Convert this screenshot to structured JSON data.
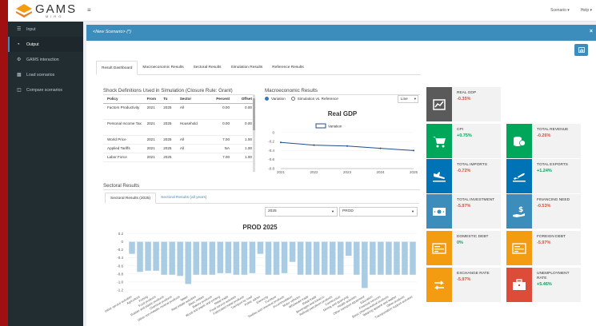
{
  "app": {
    "logo_text": "GAMS",
    "logo_sub": "MIRO"
  },
  "sidebar": {
    "items": [
      {
        "label": "Input",
        "icon": "list-icon"
      },
      {
        "label": "Output",
        "icon": "pie-chart-icon"
      },
      {
        "label": "GAMS interaction",
        "icon": "gear-icon"
      },
      {
        "label": "Load scenarios",
        "icon": "database-icon"
      },
      {
        "label": "Compare scenarios",
        "icon": "columns-icon"
      }
    ]
  },
  "topbar": {
    "scenario_menu": "Scenario ▾",
    "help_menu": "Help ▾"
  },
  "panel": {
    "title": "<New Scenario> (*)",
    "close": "×"
  },
  "tabs": [
    "Result Dashboard",
    "Macroeconomic Results",
    "Sectoral Results",
    "Simulation Results",
    "Reference Results"
  ],
  "shock": {
    "title": "Shock Definitions Used in Simulation (Closure Rule: Grant)",
    "columns": [
      "Policy",
      "From",
      "To",
      "Sector",
      "Percent",
      "Offset"
    ],
    "rows": [
      [
        "Factors Productivity",
        "2021",
        "2025",
        "All",
        "0.00",
        "0.00"
      ],
      [
        "Personal Income Tax",
        "2021",
        "2025",
        "Household",
        "0.00",
        "0.00"
      ],
      [
        "World Price",
        "2021",
        "2025",
        "All",
        "7.00",
        "1.00"
      ],
      [
        "Applied Tariffs",
        "2021",
        "2025",
        "All",
        "NA",
        "1.00"
      ],
      [
        "Labor Force",
        "2021",
        "2025",
        "",
        "7.00",
        "1.00"
      ]
    ]
  },
  "macro": {
    "title": "Macroeconomic Results",
    "radio_variation": "Variation",
    "radio_sim_ref": "Simulation vs. Reference",
    "chart_type_select": "Line"
  },
  "sectoral": {
    "title": "Sectoral Results",
    "tabs": [
      "Sectoral Results (2025)",
      "Sectoral Results (all years)"
    ],
    "year_select": "2025",
    "var_select": "PROD"
  },
  "cards": [
    {
      "label": "REAL GDP",
      "value": "-0.35%",
      "sign": "neg",
      "color": "#5a5a5a",
      "icon": "line-chart-icon"
    },
    {
      "label": "CPI",
      "value": "+0.75%",
      "sign": "pos",
      "color": "#00a65a",
      "icon": "shopping-cart-icon"
    },
    {
      "label": "TOTAL REVENUE",
      "value": "-0.26%",
      "sign": "neg",
      "color": "#00a65a",
      "icon": "coins-icon"
    },
    {
      "label": "TOTAL IMPORTS",
      "value": "-0.72%",
      "sign": "neg",
      "color": "#0073b7",
      "icon": "plane-landing-icon"
    },
    {
      "label": "TOTAL EXPORTS",
      "value": "+1.24%",
      "sign": "pos",
      "color": "#0073b7",
      "icon": "plane-departure-icon"
    },
    {
      "label": "TOTAL INVESTMENT",
      "value": "-5.97%",
      "sign": "neg",
      "color": "#3c8dbc",
      "icon": "money-bill-icon"
    },
    {
      "label": "FINANCING NEED",
      "value": "-0.53%",
      "sign": "neg",
      "color": "#3c8dbc",
      "icon": "hand-dollar-icon"
    },
    {
      "label": "DOMESTIC DEBT",
      "value": "0%",
      "sign": "pos",
      "color": "#f39c12",
      "icon": "receipt-icon"
    },
    {
      "label": "FOREIGN DEBT",
      "value": "-5.97%",
      "sign": "neg",
      "color": "#f39c12",
      "icon": "receipt-icon"
    },
    {
      "label": "EXCHANGE RATE",
      "value": "-5.97%",
      "sign": "neg",
      "color": "#f39c12",
      "icon": "exchange-icon"
    },
    {
      "label": "UNEMPLOYMENT RATE",
      "value": "+5.46%",
      "sign": "pos",
      "color": "#dd4b39",
      "icon": "briefcase-icon"
    }
  ],
  "chart_data": [
    {
      "type": "line",
      "title": "Real GDP",
      "series": [
        {
          "name": "Variation",
          "x": [
            2021,
            2022,
            2023,
            2024,
            2025
          ],
          "values": [
            -0.22,
            -0.28,
            -0.3,
            -0.35,
            -0.4
          ]
        }
      ],
      "x_ticks": [
        "2021",
        "2022",
        "2023",
        "2024",
        "2025"
      ],
      "y_ticks": [
        "0",
        "-0.2",
        "-0.4",
        "-0.6",
        "-0.8"
      ],
      "ylim": [
        -0.8,
        0.05
      ],
      "legend": "top-center",
      "color": "#1f4e8c"
    },
    {
      "type": "bar",
      "title": "PROD 2025",
      "categories": [
        "Other service activities",
        "Agriculture",
        "Fishing",
        "Food products",
        "Rubber and plastic products",
        "Chemical products",
        "Other non-metallic mineral products",
        "Water",
        "Real estate activities",
        "Basic metals",
        "Bakery products",
        "Wood and paper and printing",
        "Metal trade",
        "Food service activities",
        "Fabricated metal products",
        "Transport by road",
        "Public admin",
        "Electricity",
        "Furniture",
        "Textiles and chemical products",
        "Accommodation",
        "Motor vehicles",
        "Wholesale trade",
        "Retail trade",
        "Beverages and tobacco",
        "Refined petroleum products",
        "Construction",
        "Mining and quarrying",
        "Health activities",
        "Other transport equipment",
        "Education",
        "Financial services",
        "Basic pharmaceutical products",
        "Wearing apparel and leather",
        "Other products",
        "Transportation support activities"
      ],
      "values": [
        -0.3,
        -0.75,
        -0.72,
        -0.72,
        -0.82,
        -0.82,
        -0.85,
        -1.05,
        -0.82,
        -0.82,
        -0.82,
        -0.78,
        -0.78,
        -0.82,
        -0.82,
        -0.78,
        -0.3,
        -0.82,
        -0.82,
        -0.78,
        -0.5,
        -0.82,
        -0.82,
        -0.82,
        -0.82,
        -0.82,
        -0.82,
        -0.35,
        -0.82,
        -1.15,
        -0.82,
        -0.82,
        -0.82,
        -0.82,
        -0.82,
        -0.82
      ],
      "y_ticks": [
        "0.2",
        "0",
        "-0.2",
        "-0.4",
        "-0.6",
        "-0.8",
        "-1.0",
        "-1.2"
      ],
      "ylim": [
        -1.3,
        0.25
      ],
      "color": "#a9cce3"
    }
  ]
}
